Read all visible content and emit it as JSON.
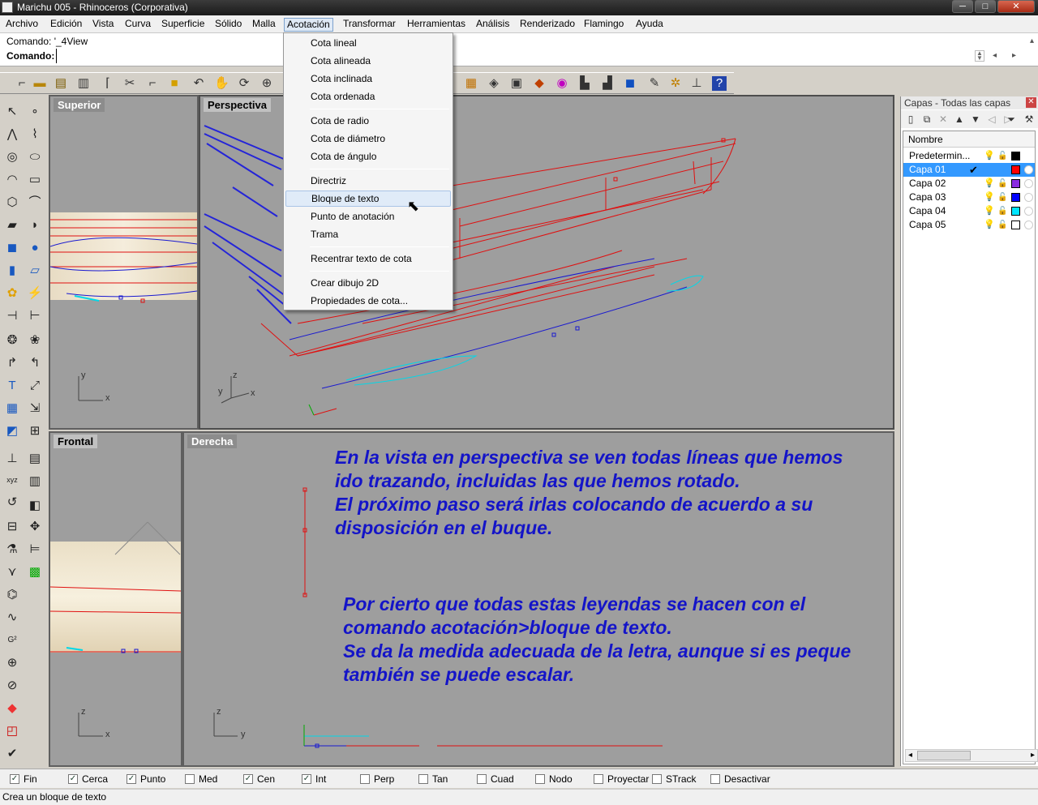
{
  "window": {
    "title": "Marichu 005 - Rhinoceros (Corporativa)",
    "min": "─",
    "max": "□",
    "close": "✕"
  },
  "menubar": [
    "Archivo",
    "Edición",
    "Vista",
    "Curva",
    "Superficie",
    "Sólido",
    "Malla",
    "Acotación",
    "Transformar",
    "Herramientas",
    "Análisis",
    "Renderizado",
    "Flamingo",
    "Ayuda"
  ],
  "command": {
    "history": "Comando: '_4View",
    "prompt": "Comando:"
  },
  "dropdown": {
    "items": [
      "Cota lineal",
      "Cota alineada",
      "Cota inclinada",
      "Cota ordenada",
      "Cota de radio",
      "Cota de diámetro",
      "Cota de ángulo",
      "Directriz",
      "Bloque de texto",
      "Punto de anotación",
      "Trama",
      "Recentrar texto de cota",
      "Crear dibujo 2D",
      "Propiedades de cota..."
    ],
    "highlighted": "Bloque de texto"
  },
  "viewports": {
    "top": "Superior",
    "perspective": "Perspectiva",
    "front": "Frontal",
    "right": "Derecha"
  },
  "axes": {
    "x": "x",
    "y": "y",
    "z": "z"
  },
  "annotations": {
    "note1": "En la vista en perspectiva se ven todas líneas que hemos\nido trazando, incluidas las que hemos rotado.\nEl próximo paso será irlas colocando de acuerdo a su\ndisposición en el buque.",
    "note2": "Por cierto que todas estas leyendas se hacen con el\ncomando acotación>bloque de texto.\nSe da la medida adecuada de la letra, aunque si es peque\ntambién se puede escalar."
  },
  "layers": {
    "title": "Capas - Todas las capas",
    "column": "Nombre",
    "rows": [
      {
        "name": "Predetermin...",
        "color": "#000000",
        "selected": false
      },
      {
        "name": "Capa 01",
        "color": "#ff0000",
        "selected": true
      },
      {
        "name": "Capa 02",
        "color": "#8a2be2",
        "selected": false
      },
      {
        "name": "Capa 03",
        "color": "#0000ff",
        "selected": false
      },
      {
        "name": "Capa 04",
        "color": "#00e5ff",
        "selected": false
      },
      {
        "name": "Capa 05",
        "color": "#ffffff",
        "selected": false
      }
    ]
  },
  "osnaps": [
    {
      "label": "Fin",
      "checked": true
    },
    {
      "label": "Cerca",
      "checked": true
    },
    {
      "label": "Punto",
      "checked": true
    },
    {
      "label": "Med",
      "checked": false
    },
    {
      "label": "Cen",
      "checked": true
    },
    {
      "label": "Int",
      "checked": true
    },
    {
      "label": "Perp",
      "checked": false
    },
    {
      "label": "Tan",
      "checked": false
    },
    {
      "label": "Cuad",
      "checked": false
    },
    {
      "label": "Nodo",
      "checked": false
    },
    {
      "label": "Proyectar",
      "checked": false
    },
    {
      "label": "STrack",
      "checked": false
    },
    {
      "label": "Desactivar",
      "checked": false
    }
  ],
  "status": "Crea un bloque de texto",
  "colors": {
    "curve_red": "#e01010",
    "curve_blue": "#1a1ad0",
    "curve_cyan": "#00d8e8",
    "note_blue": "#1414c8",
    "viewport_bg": "#9e9e9e"
  }
}
